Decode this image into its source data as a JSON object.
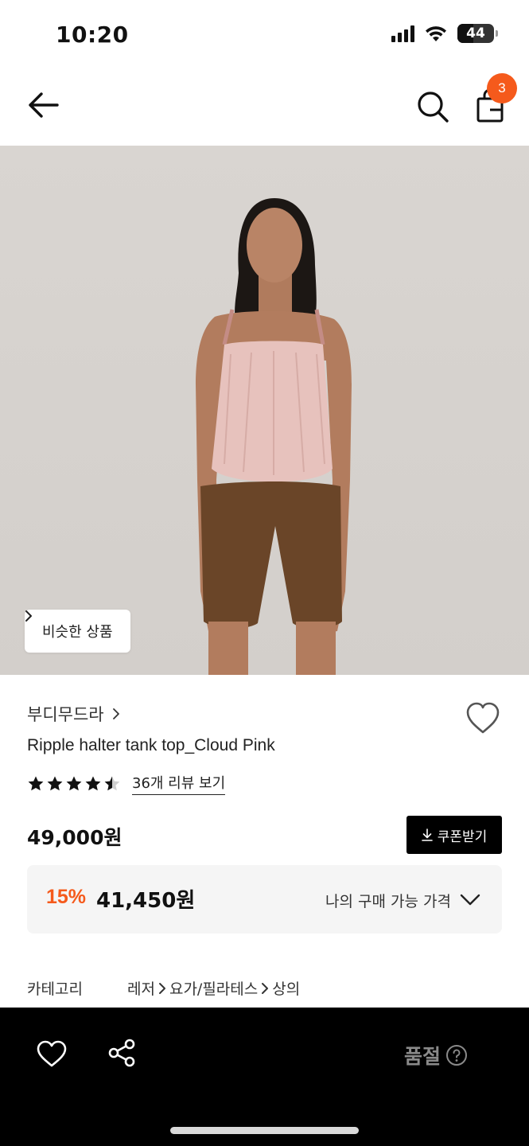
{
  "status_bar": {
    "time": "10:20",
    "battery": "44",
    "battery_level": 0.44
  },
  "nav": {
    "cart_count": "3"
  },
  "hero": {
    "similar_label": "비슷한 상품"
  },
  "product": {
    "brand": "부디무드라",
    "title": "Ripple halter tank top_Cloud Pink",
    "rating": 4.5,
    "rating_max": 5,
    "review_link": "36개 리뷰 보기",
    "price": "49,000원",
    "coupon_label": "쿠폰받기"
  },
  "discount": {
    "percent": "15%",
    "price": "41,450원",
    "best_price_label": "나의 구매 가능 가격"
  },
  "category": {
    "label": "카테고리",
    "path": [
      "레저",
      "요가/필라테스",
      "상의"
    ]
  },
  "bottom_bar": {
    "soldout_label": "품절"
  },
  "colors": {
    "accent": "#f55a1c",
    "dark": "#000000",
    "muted": "#8a8a8a"
  },
  "icons": [
    "back-arrow-icon",
    "search-icon",
    "shopping-bag-icon",
    "chevron-right-icon",
    "heart-icon",
    "star-icon",
    "download-icon",
    "chevron-down-icon",
    "share-icon",
    "help-icon"
  ]
}
